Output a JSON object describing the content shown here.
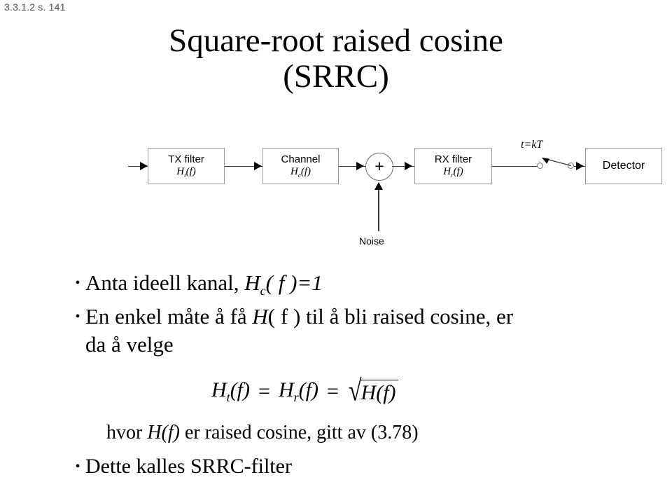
{
  "slide": {
    "header": "3.3.1.2 s. 141",
    "title_line1": "Square-root raised cosine",
    "title_line2": "(SRRC)"
  },
  "diagram": {
    "blocks": [
      {
        "label": "TX filter",
        "transfer_base": "H",
        "transfer_sub": "t",
        "transfer_arg": "(f)"
      },
      {
        "label": "Channel",
        "transfer_base": "H",
        "transfer_sub": "c",
        "transfer_arg": "(f)"
      },
      {
        "label": "RX filter",
        "transfer_base": "H",
        "transfer_sub": "r",
        "transfer_arg": "(f)"
      },
      {
        "label": "Detector",
        "transfer_base": "",
        "transfer_sub": "",
        "transfer_arg": ""
      }
    ],
    "sum_symbol": "+",
    "sampling_label": "t=kT",
    "noise_label": "Noise"
  },
  "body": {
    "bullet_char": "•",
    "bullet1": {
      "pre": "Anta ideell kanal, ",
      "sym_base": "H",
      "sym_sub": "c",
      "sym_arg": "( f )=1"
    },
    "bullet2": {
      "pre": "En enkel måte å få ",
      "sym": "H",
      "mid": "( f ) til å bli raised cosine, er",
      "line2": "da å velge"
    },
    "equation": {
      "lhs_base": "H",
      "lhs_sub": "t",
      "lhs_arg": "(f)",
      "eq1": "=",
      "mid_base": "H",
      "mid_sub": "r",
      "mid_arg": "(f)",
      "eq2": "=",
      "sqrt_symbol": "√",
      "radicand": "H(f)"
    },
    "bullet3": {
      "pre": "hvor ",
      "sym": "H(f)",
      "post": " er raised cosine, gitt av (3.78)"
    },
    "bullet4": {
      "text": "Dette kalles SRRC-filter"
    }
  }
}
